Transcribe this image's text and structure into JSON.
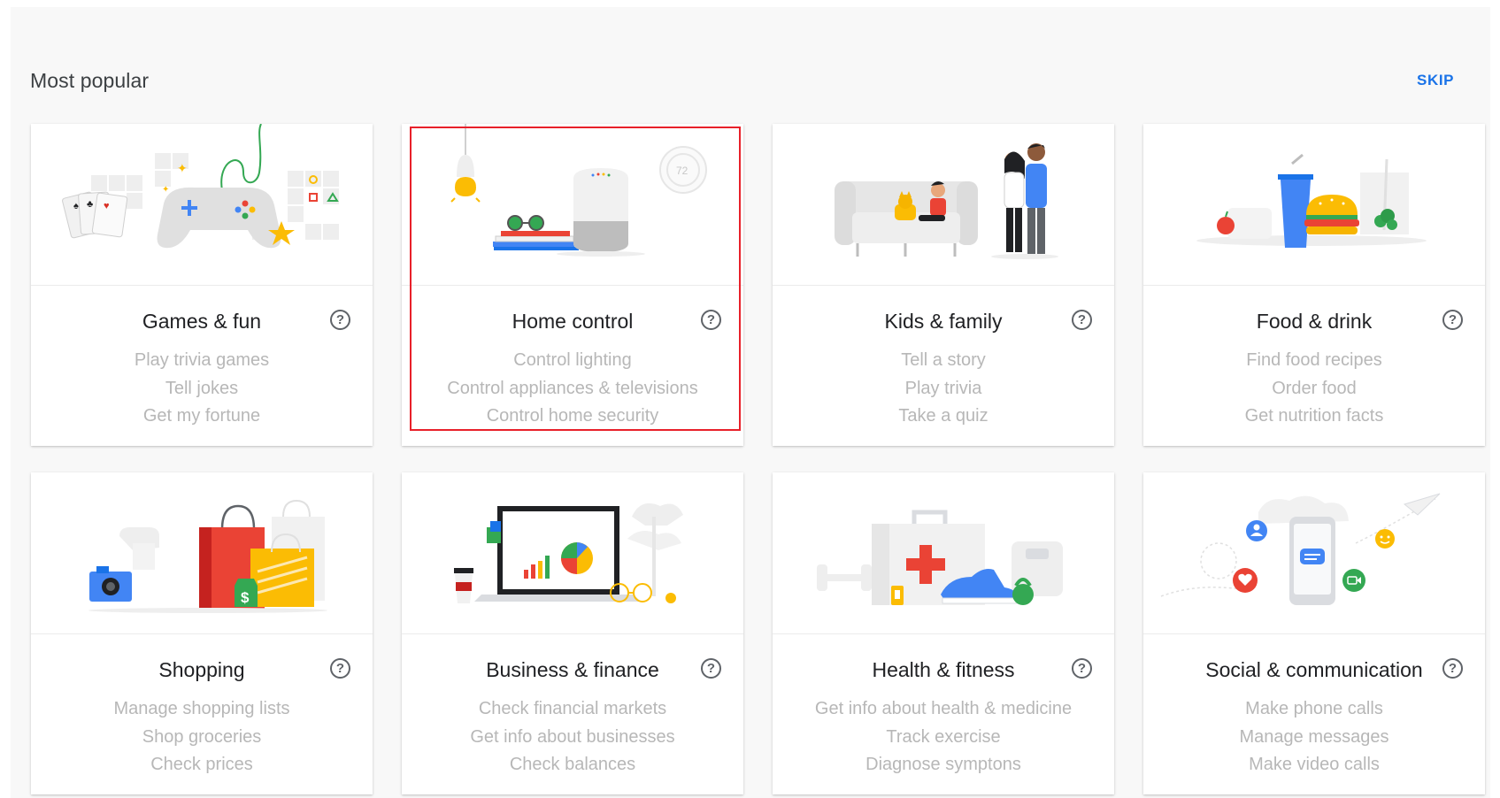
{
  "header": {
    "section_title": "Most popular",
    "skip_label": "SKIP"
  },
  "accent_color": "#1a73e8",
  "highlight_color": "#e8202a",
  "cards": [
    {
      "title": "Games & fun",
      "examples": [
        "Play trivia games",
        "Tell jokes",
        "Get my fortune"
      ],
      "illustration": "game-controller-illustration"
    },
    {
      "title": "Home control",
      "examples": [
        "Control lighting",
        "Control appliances & televisions",
        "Control home security"
      ],
      "illustration": "smart-speaker-illustration",
      "thermostat_reading": "72"
    },
    {
      "title": "Kids & family",
      "examples": [
        "Tell a story",
        "Play trivia",
        "Take a quiz"
      ],
      "illustration": "family-couch-illustration"
    },
    {
      "title": "Food & drink",
      "examples": [
        "Find food recipes",
        "Order food",
        "Get nutrition facts"
      ],
      "illustration": "burger-drink-illustration"
    },
    {
      "title": "Shopping",
      "examples": [
        "Manage shopping lists",
        "Shop groceries",
        "Check prices"
      ],
      "illustration": "shopping-bags-illustration",
      "price_tag_symbol": "$"
    },
    {
      "title": "Business & finance",
      "examples": [
        "Check financial markets",
        "Get info about businesses",
        "Check balances"
      ],
      "illustration": "laptop-chart-illustration"
    },
    {
      "title": "Health & fitness",
      "examples": [
        "Get info about health & medicine",
        "Track exercise",
        "Diagnose symptons"
      ],
      "illustration": "first-aid-illustration"
    },
    {
      "title": "Social & communication",
      "examples": [
        "Make phone calls",
        "Manage messages",
        "Make video calls"
      ],
      "illustration": "phone-social-illustration"
    }
  ],
  "help_icon_glyph": "?"
}
